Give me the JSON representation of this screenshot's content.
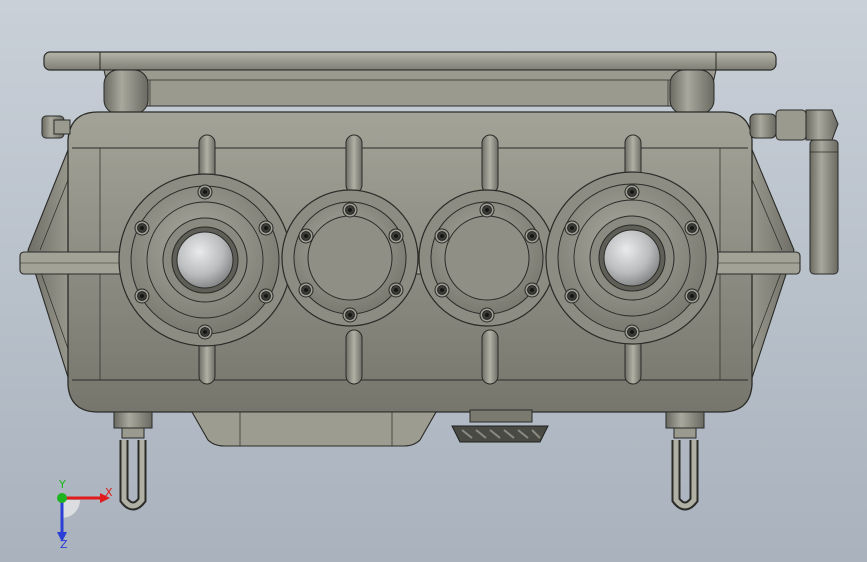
{
  "viewport": {
    "background_top": "#c9d0d8",
    "background_bottom": "#a9b2bd"
  },
  "model": {
    "part_color": "#8e8e84",
    "edge_color": "#2b2b28",
    "bolt_icon": "socket-head-bolt-icon"
  },
  "triad": {
    "x_label": "X",
    "y_label": "Y",
    "z_label": "Z",
    "x_color": "#e01b1b",
    "y_color": "#1fb31f",
    "z_color": "#2a3fd6"
  }
}
